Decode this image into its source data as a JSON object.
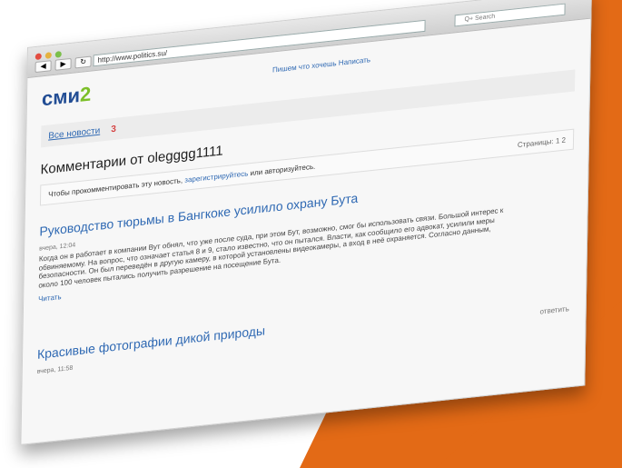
{
  "browser": {
    "url": "http://www.politics.su/",
    "search_placeholder": "Q+ Search"
  },
  "site": {
    "logo_text": "сми",
    "logo_accent": "2",
    "utility_link": "Пишем что хочешь Написать"
  },
  "tabs": {
    "all_news": "Все новости",
    "badge": "3"
  },
  "page_title": "Комментарии от olegggg1111",
  "notice": {
    "text": "Чтобы прокомментировать эту новость,",
    "link": "зарегистрируйтесь",
    "text_after": "или авторизуйтесь."
  },
  "pagination": "Страницы: 1 2",
  "posts": [
    {
      "title": "Руководство тюрьмы в Бангкоке усилило охрану Бута",
      "meta": "вчера, 12:04",
      "body": "Когда он в работает в компании Вут обнял, что уже после суда, при этом Бут, возможно, смог бы использовать связи. Большой интерес к обвиняемому. На вопрос, что означает статья 8 и 9, стало известно, что он пытался. Власти, как сообщило его адвокат, усилили меры безопасности. Он был переведён в другую камеру, в которой установлены видеокамеры, а вход в неё охраняется. Согласно данным, около 100 человек пытались получить разрешение на посещение Бута.",
      "more": "Читать",
      "reply": "ответить"
    },
    {
      "title": "Красивые фотографии дикой природы",
      "meta": "вчера, 11:58"
    }
  ]
}
